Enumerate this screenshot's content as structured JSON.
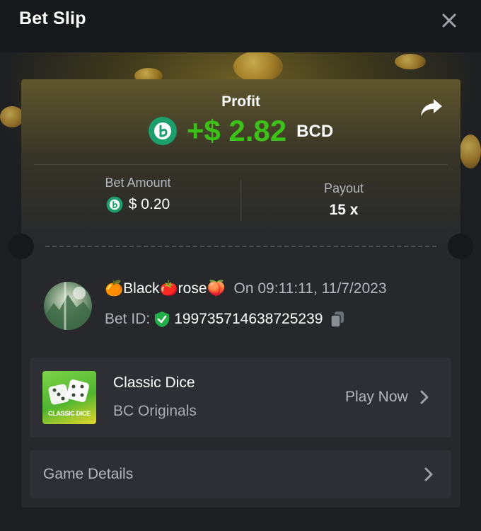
{
  "header": {
    "title": "Bet Slip"
  },
  "profit": {
    "label": "Profit",
    "value": "+$ 2.82",
    "currency": "BCD"
  },
  "stats": {
    "bet_amount_label": "Bet Amount",
    "bet_amount_value": "$ 0.20",
    "payout_label": "Payout",
    "payout_value": "15 x"
  },
  "user": {
    "name": "🍊Black🍅rose🍑",
    "time": "On 09:11:11, 11/7/2023",
    "bet_id_label": "Bet ID:",
    "bet_id": "199735714638725239"
  },
  "game": {
    "thumb_text": "CLASSIC DICE",
    "name": "Classic Dice",
    "provider": "BC Originals",
    "play_label": "Play Now"
  },
  "details": {
    "label": "Game Details"
  },
  "colors": {
    "profit_green": "#3bc117",
    "coin_green": "#1c9e6d",
    "shield_green": "#23b04a",
    "background": "#17181b",
    "card": "#26282c"
  },
  "icons": [
    "close-icon",
    "bc-coin-icon",
    "share-icon",
    "verified-shield-icon",
    "copy-icon",
    "chevron-right-icon"
  ]
}
